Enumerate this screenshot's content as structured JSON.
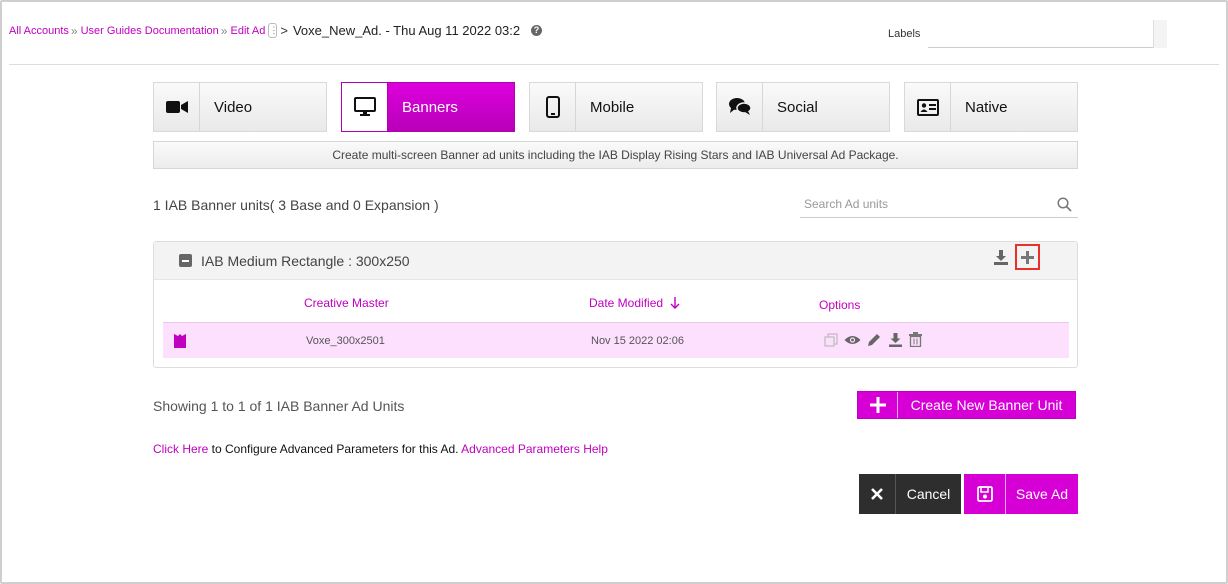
{
  "breadcrumb": {
    "items": [
      "All Accounts",
      "User Guides Documentation",
      "Edit Ad"
    ],
    "separator": "»",
    "current": "Voxe_New_Ad.  - Thu Aug 11 2022 03:2",
    "gt": ">"
  },
  "labels": {
    "label": "Labels",
    "value": ""
  },
  "tabs": [
    {
      "label": "Video",
      "icon": "video-camera-icon",
      "active": false
    },
    {
      "label": "Banners",
      "icon": "monitor-icon",
      "active": true
    },
    {
      "label": "Mobile",
      "icon": "mobile-phone-icon",
      "active": false
    },
    {
      "label": "Social",
      "icon": "chat-bubbles-icon",
      "active": false
    },
    {
      "label": "Native",
      "icon": "id-card-icon",
      "active": false
    }
  ],
  "description": "Create multi-screen Banner ad units including the IAB Display Rising Stars and IAB Universal Ad Package.",
  "units_summary": "1 IAB Banner units( 3 Base and 0 Expansion )",
  "search": {
    "placeholder": "Search Ad units",
    "value": ""
  },
  "panel": {
    "title": "IAB Medium Rectangle : 300x250",
    "columns": [
      "Creative Master",
      "Date Modified",
      "Options"
    ],
    "rows": [
      {
        "creative_master": "Voxe_300x2501",
        "date_modified": "Nov 15 2022 02:06"
      }
    ]
  },
  "showing": "Showing 1 to 1 of 1 IAB Banner Ad Units",
  "create_button": "Create New Banner Unit",
  "advanced": {
    "link1": "Click Here",
    "text": " to Configure Advanced Parameters for this Ad. ",
    "link2": "Advanced Parameters Help"
  },
  "buttons": {
    "cancel": "Cancel",
    "save": "Save Ad"
  },
  "colors": {
    "accent": "#d600d6",
    "dark": "#2e2e2e",
    "highlight": "#e8312a",
    "row_bg": "#fde0fd"
  }
}
